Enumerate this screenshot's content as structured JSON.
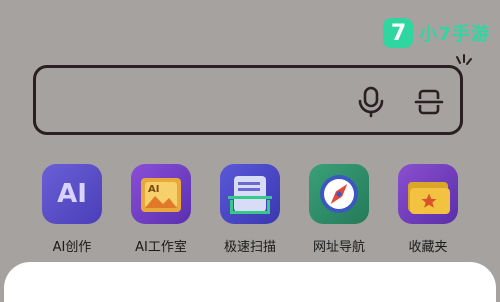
{
  "watermark": {
    "badge_text": "7",
    "text": "小7手游"
  },
  "search": {
    "value": ""
  },
  "apps": [
    {
      "label": "AI创作",
      "icon": "ai-create-icon"
    },
    {
      "label": "AI工作室",
      "icon": "ai-studio-icon"
    },
    {
      "label": "极速扫描",
      "icon": "fast-scan-icon"
    },
    {
      "label": "网址导航",
      "icon": "url-navigation-icon"
    },
    {
      "label": "收藏夹",
      "icon": "favorites-icon"
    }
  ],
  "colors": {
    "background": "#a5a29f",
    "watermark": "#2fd6a0",
    "ai_create": "#5a4fc4",
    "ai_studio": "#6f3fc4",
    "fast_scan": "#4b49c8",
    "url_nav": "#2f8f6d",
    "favorites": "#7a3fc0"
  }
}
